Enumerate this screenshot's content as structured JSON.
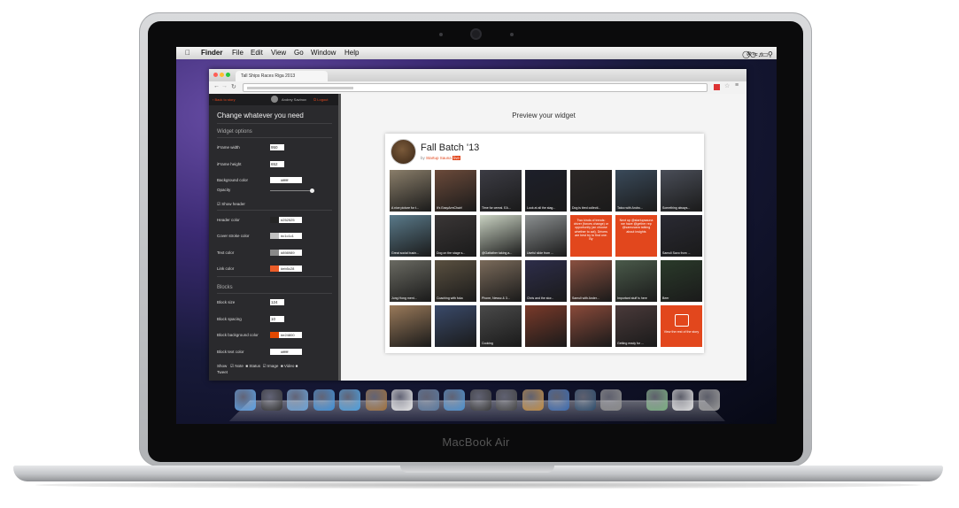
{
  "laptop": {
    "brand": "MacBook Air"
  },
  "menubar": {
    "apple": "",
    "items": [
      "Finder",
      "File",
      "Edit",
      "View",
      "Go",
      "Window",
      "Help"
    ]
  },
  "browser": {
    "tab_title": "Tall Ships Races Riga 2013"
  },
  "editor": {
    "back_link": "Back to story",
    "user_name": "Andrey Savinov",
    "logout": "Logout",
    "heading": "Change whatever you need",
    "widget_options": "Widget options",
    "iframe_width_label": "iFrame width",
    "iframe_width": "950",
    "iframe_height_label": "iFrame height",
    "iframe_height": "652",
    "background_color_label": "Background color",
    "background_color": "#ffffff",
    "opacity_label": "Opacity",
    "opacity": 1,
    "show_header_label": "Show header",
    "header_color_label": "Header color",
    "header_color": "#252525",
    "cover_stroke_label": "Cover stroke color",
    "cover_stroke": "#c1c1c1",
    "text_color_label": "Text color",
    "text_color": "#898989",
    "link_color_label": "Link color",
    "link_color": "#eb5c28",
    "blocks_heading": "Blocks",
    "block_size_label": "Block size",
    "block_size": "124",
    "block_spacing_label": "Block spacing",
    "block_spacing": "10",
    "block_bg_label": "Block background color",
    "block_bg": "#e24800",
    "block_text_label": "Block text color",
    "block_text": "#ffffff",
    "show_label": "Show",
    "show_options": [
      "Note",
      "Status",
      "Image",
      "Video",
      "Tweet"
    ]
  },
  "preview": {
    "title": "Preview your widget",
    "widget_title": "Fall Batch '13",
    "by": "by",
    "author": "Startup Sauna",
    "author_badge": "live",
    "tiles": [
      {
        "type": "photo",
        "caption": "A nice picture for t...",
        "color": "#8a7e6a"
      },
      {
        "type": "photo",
        "caption": "It's EasyArmChair!",
        "color": "#6b4a3a"
      },
      {
        "type": "photo",
        "caption": "Time for cereal. EA...",
        "color": "#3c3c44"
      },
      {
        "type": "photo",
        "caption": "Look at all the stag...",
        "color": "#1d1f2a"
      },
      {
        "type": "photo",
        "caption": "Dog is tired collecti...",
        "color": "#2b2726"
      },
      {
        "type": "photo",
        "caption": "Tatoo with Andro...",
        "color": "#3a4a5a"
      },
      {
        "type": "photo",
        "caption": "Something always...",
        "color": "#4a4e58"
      },
      {
        "type": "photo",
        "caption": "Great social busin...",
        "color": "#5a7a8a"
      },
      {
        "type": "photo",
        "caption": "Dog on the stage s...",
        "color": "#3a3636"
      },
      {
        "type": "photo",
        "caption": "@Gatfather taking a...",
        "color": "#c9d2c2"
      },
      {
        "type": "photo",
        "caption": "Useful slide from ...",
        "color": "#8b8f90"
      },
      {
        "type": "note",
        "caption": "Two kinds of trends: driver (forces change) or opportunity (an choose whether to act). Drivers are best try to find one. By",
        "color": "#e2471d"
      },
      {
        "type": "note",
        "caption": "Next up @startupsauna we have @gether rep @samusava talking about insights",
        "color": "#e2471d"
      },
      {
        "type": "photo",
        "caption": "Samuli Savo from ...",
        "color": "#2a2a33"
      },
      {
        "type": "photo",
        "caption": "Jung Hong ment...",
        "color": "#6a6a62"
      },
      {
        "type": "photo",
        "caption": "Coaching with foka",
        "color": "#5a5040"
      },
      {
        "type": "photo",
        "caption": "Phone, Newsc & 3...",
        "color": "#7a6a5a"
      },
      {
        "type": "photo",
        "caption": "Chris and the stor...",
        "color": "#2d2d4a"
      },
      {
        "type": "photo",
        "caption": "Samuli with Ander...",
        "color": "#8a5040"
      },
      {
        "type": "photo",
        "caption": "Important stuff is here",
        "color": "#4a5a4a"
      },
      {
        "type": "photo",
        "caption": "Beer",
        "color": "#2a3a2a"
      },
      {
        "type": "photo",
        "caption": "",
        "color": "#9a7a5a"
      },
      {
        "type": "photo",
        "caption": "",
        "color": "#3a4a6a"
      },
      {
        "type": "photo",
        "caption": "Cooking",
        "color": "#4a4a4a"
      },
      {
        "type": "photo",
        "caption": "",
        "color": "#7a3a2a"
      },
      {
        "type": "photo",
        "caption": "",
        "color": "#8a4a3a"
      },
      {
        "type": "photo",
        "caption": "Getting ready for ...",
        "color": "#4a3a3a"
      },
      {
        "type": "story",
        "caption": "View the rest of the story",
        "color": "#e2471d"
      }
    ]
  }
}
